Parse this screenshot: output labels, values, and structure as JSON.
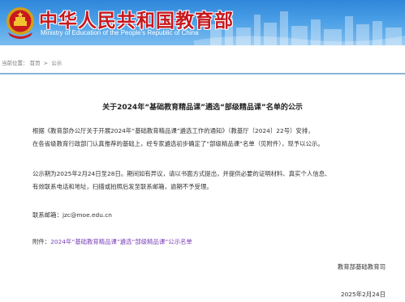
{
  "header": {
    "title": "中华人民共和国教育部",
    "subtitle": "Ministry of Education of the People's Republic of China"
  },
  "breadcrumb": {
    "prefix": "当前位置：",
    "items": [
      "首页",
      "公示"
    ],
    "separator": ">"
  },
  "article": {
    "title": "关于2024年“基础教育精品课”遴选“部级精品课”名单的公示",
    "paragraph1": [
      "根据《教育部办公厅关于开展2024年“基础教育精品课”遴选工作的通知》（教基厅〔2024〕22号）安排，",
      "在各省级教育行政部门认真推荐的基础上，经专家遴选初步确定了“部级精品课”名单（见附件），现予以公示。"
    ],
    "paragraph2": [
      "公示期为2025年2月24日至28日。期间如有异议，请以书面方式提出，并提供必要的证明材料、真实个人信息、",
      "有效联系电话和地址，扫描或拍照后发至联系邮箱，逾期不予受理。"
    ],
    "email_label": "联系邮箱：",
    "email": "jzc@moe.edu.cn",
    "attachment_label": "附件：",
    "attachment_link": "2024年“基础教育精品课”遴选“部级精品课”公示名单",
    "signature": "教育部基础教育司",
    "date": "2025年2月24日"
  },
  "colors": {
    "banner": "#3a8fde",
    "title_red": "#c8181e",
    "link_purple": "#7a3fb8",
    "divider": "#8ab4d8"
  },
  "icons": {
    "emblem": "national-emblem-icon"
  }
}
